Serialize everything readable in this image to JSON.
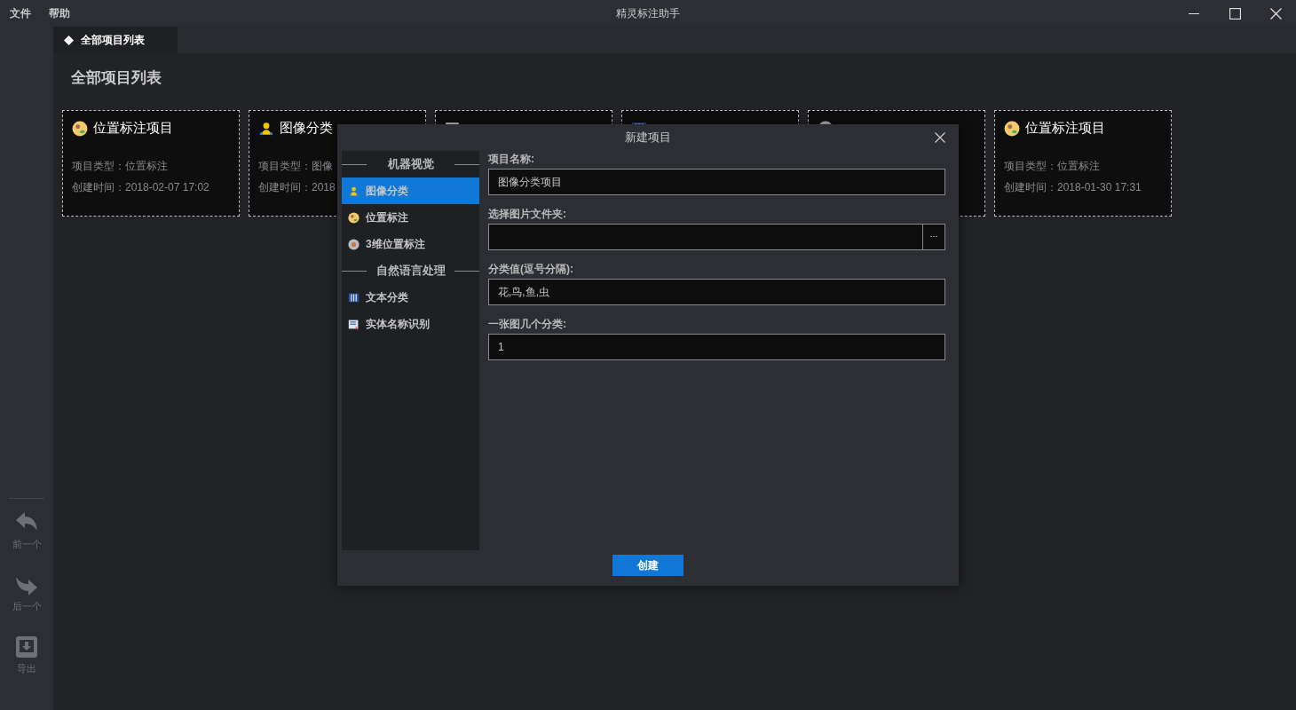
{
  "menu": [
    "文件",
    "帮助"
  ],
  "window": {
    "title": "精灵标注助手"
  },
  "tabs": [
    {
      "label": "全部项目列表",
      "selected": true
    }
  ],
  "page_title": "全部项目列表",
  "cards": [
    {
      "kind": "location",
      "title": "位置标注项目",
      "type": "项目类型：位置标注",
      "created": "创建时间：2018-02-07 17:02"
    },
    {
      "kind": "person",
      "title": "图像分类",
      "type": "项目类型：图像",
      "created": "创建时间：2018"
    },
    {
      "kind": "entity"
    },
    {
      "kind": "text"
    },
    {
      "kind": "cube"
    },
    {
      "kind": "location",
      "title": "位置标注项目",
      "type": "项目类型：位置标注",
      "created": "创建时间：2018-01-30 17:31"
    }
  ],
  "sidebar": [
    {
      "kind": "back",
      "label": "前一个"
    },
    {
      "kind": "forward",
      "label": "后一个"
    },
    {
      "kind": "export",
      "label": "导出"
    }
  ],
  "dialog": {
    "title": "新建项目",
    "categories": [
      {
        "kind": "header",
        "label": "机器视觉"
      },
      {
        "kind": "person",
        "label": "图像分类",
        "selected": true
      },
      {
        "kind": "location",
        "label": "位置标注",
        "selected": false
      },
      {
        "kind": "cube",
        "label": "3维位置标注",
        "selected": false
      },
      {
        "kind": "header",
        "label": "自然语言处理"
      },
      {
        "kind": "text",
        "label": "文本分类",
        "selected": false
      },
      {
        "kind": "entity",
        "label": "实体名称识别",
        "selected": false
      }
    ],
    "fields": [
      {
        "kind": "text",
        "label": "项目名称:",
        "value": "图像分类项目"
      },
      {
        "kind": "folder",
        "label": "选择图片文件夹:",
        "button": "···"
      },
      {
        "kind": "text",
        "label": "分类值(逗号分隔):",
        "value": "花,鸟,鱼,虫"
      },
      {
        "kind": "text",
        "label": "一张图几个分类:",
        "value": "1"
      }
    ],
    "submit": "创建"
  }
}
